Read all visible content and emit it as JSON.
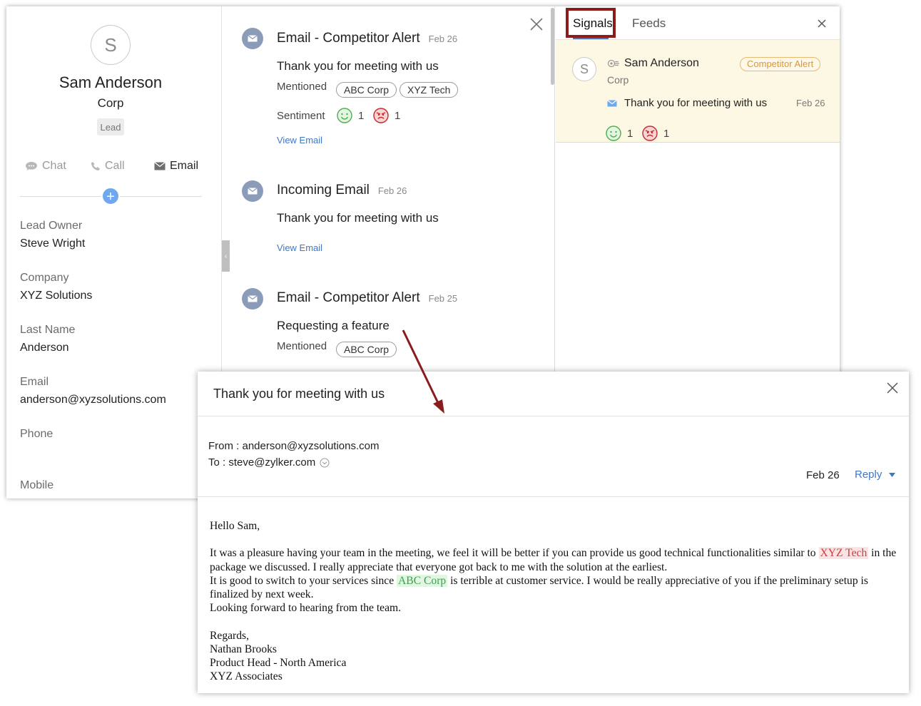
{
  "profile": {
    "avatar_initial": "S",
    "name": "Sam Anderson",
    "company": "Corp",
    "badge": "Lead",
    "actions": {
      "chat": "Chat",
      "call": "Call",
      "email": "Email"
    },
    "add_label": "+",
    "fields": [
      {
        "label": "Lead Owner",
        "value": "Steve Wright"
      },
      {
        "label": "Company",
        "value": "XYZ Solutions"
      },
      {
        "label": "Last Name",
        "value": "Anderson"
      },
      {
        "label": "Email",
        "value": "anderson@xyzsolutions.com"
      },
      {
        "label": "Phone",
        "value": ""
      },
      {
        "label": "Mobile",
        "value": ""
      }
    ]
  },
  "timeline": {
    "items": [
      {
        "title": "Email - Competitor Alert",
        "date": "Feb 26",
        "subject": "Thank you for meeting with us",
        "mentioned_label": "Mentioned",
        "mentions": [
          "ABC Corp",
          "XYZ Tech"
        ],
        "sentiment_label": "Sentiment",
        "positive_count": "1",
        "negative_count": "1",
        "link": "View Email"
      },
      {
        "title": "Incoming Email",
        "date": "Feb 26",
        "subject": "Thank you for meeting with us",
        "link": "View Email"
      },
      {
        "title": "Email - Competitor Alert",
        "date": "Feb 25",
        "subject": "Requesting a feature",
        "mentioned_label": "Mentioned",
        "mentions": [
          "ABC Corp"
        ]
      }
    ]
  },
  "signals": {
    "tabs": [
      "Signals",
      "Feeds"
    ],
    "active_tab": "Signals",
    "card": {
      "avatar_initial": "S",
      "name": "Sam Anderson",
      "company": "Corp",
      "badge": "Competitor Alert",
      "subject": "Thank you for meeting with us",
      "date": "Feb 26",
      "positive_count": "1",
      "negative_count": "1"
    }
  },
  "email_popup": {
    "title": "Thank you for meeting with us",
    "from": "From : anderson@xyzsolutions.com",
    "to": "To : steve@zylker.com",
    "date": "Feb 26",
    "reply_label": "Reply",
    "greeting": "Hello Sam,",
    "para1_a": "It was a pleasure having your team in the meeting, we feel it will be better if you can provide us good technical functionalities similar to ",
    "para1_hl": "XYZ Tech",
    "para1_b": " in the package we discussed. I really appreciate that everyone got back to me with the solution at the earliest.",
    "para2_a": "It is good to switch to your services since ",
    "para2_hl": "ABC Corp",
    "para2_b": " is terrible at customer service. I would be really appreciative of you if the preliminary setup is finalized by next week.",
    "para3": "Looking forward to hearing from the team.",
    "signature": [
      "Regards,",
      "Nathan Brooks",
      "Product Head - North America",
      "XYZ Associates"
    ]
  },
  "colors": {
    "accent": "#3b78c9",
    "tab_highlight": "#8b1c1c",
    "annotation_arrow": "#8b1c1c",
    "signal_card_bg": "#fdf8e3",
    "competitor_badge": "#d49a3a",
    "positive": "#3aa34a",
    "negative": "#d33a3a"
  }
}
